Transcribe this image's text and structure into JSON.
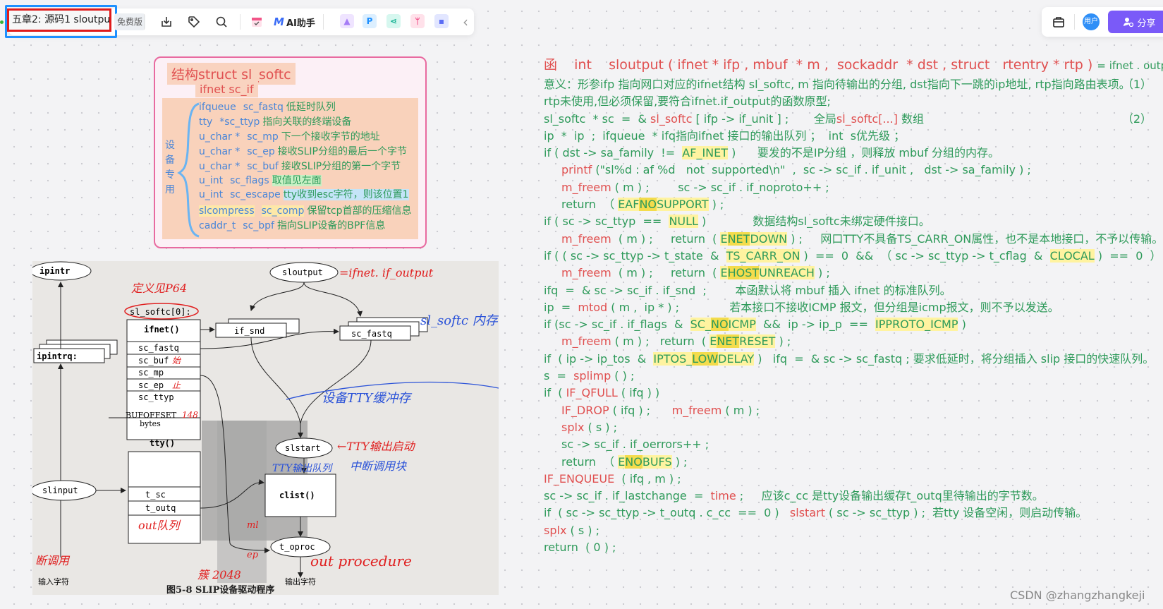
{
  "toolbar": {
    "doc_title": "五章2: 源码1 sloutput",
    "plan_badge": "免费版",
    "icons": [
      "download-icon",
      "tag-icon",
      "search-icon",
      "calendar-icon"
    ],
    "ai_label": "AI助手",
    "app_icons": [
      {
        "name": "image-app",
        "glyph": "▲",
        "bg": "#efe4ff",
        "fg": "#a57cf6"
      },
      {
        "name": "p-app",
        "glyph": "P",
        "bg": "#dcefff",
        "fg": "#1e90ff"
      },
      {
        "name": "mindmap-app",
        "glyph": "⋖",
        "bg": "#d6f7ef",
        "fg": "#19b394"
      },
      {
        "name": "flow-app",
        "glyph": "ᛘ",
        "bg": "#ffe1ea",
        "fg": "#f0508a"
      },
      {
        "name": "chat-app",
        "glyph": "▪",
        "bg": "#e2e6ff",
        "fg": "#5a6cf5"
      }
    ],
    "collapse_glyph": "‹"
  },
  "right_toolbar": {
    "briefcase_glyph": "⌂",
    "avatar_label": "用户",
    "share_label": "分享",
    "share_color": "#7a5af8"
  },
  "struct_card": {
    "title": "结构struct   sl_softc",
    "subtitle": "ifnet   sc_if",
    "vertical_label": [
      "设",
      "备",
      "专",
      "用"
    ],
    "fields": [
      {
        "type": "ifqueue",
        "name": "sc_fastq",
        "desc": "低延时队列",
        "hl": ""
      },
      {
        "type": "tty",
        "name": "*sc_ttyp",
        "desc": "指向关联的终端设备",
        "hl": ""
      },
      {
        "type": "u_char *",
        "name": "sc_mp",
        "desc": "下一个接收字节的地址",
        "hl": ""
      },
      {
        "type": "u_char *",
        "name": "sc_ep",
        "desc": "接收SLIP分组的最后一个字节",
        "hl": ""
      },
      {
        "type": "u_char *",
        "name": "sc_buf",
        "desc": "接收SLIP分组的第一个字节",
        "hl": ""
      },
      {
        "type": "u_int",
        "name": "sc_flags",
        "desc": "取值见左面",
        "hl": "green"
      },
      {
        "type": "u_int",
        "name": "sc_escape",
        "desc": "tty收到esc字符，则该位置1",
        "hl": "blue"
      },
      {
        "type": "slcompress",
        "name": "sc_comp",
        "desc": "保留tcp首部的压缩信息",
        "hl": "yellow-type"
      },
      {
        "type": "caddr_t",
        "name": "sc_bpf",
        "desc": "指向SLIP设备的BPF信息",
        "hl": ""
      }
    ]
  },
  "photo": {
    "caption": "图5-8  SLIP设备驱动程序",
    "nodes": [
      "ipintr",
      "ipintrq:",
      "sloutput",
      "sl_softc[0]:",
      "ifnet()",
      "sc_fastq",
      "sc_buf",
      "sc_mp",
      "sc_ep",
      "sc_ttyp",
      "if_snd",
      "sc_fastq",
      "BUFOFFSET",
      "bytes",
      "slstart",
      "tty()",
      "t_sc",
      "t_outq",
      "clist()",
      "slinput",
      "t_oproc",
      "输入字符",
      "输出字符"
    ],
    "annotations_red": [
      "=ifnet. if_output",
      "定义见P64",
      "始",
      "止",
      "148",
      "←TTY输出启动",
      "out队列",
      "ml",
      "ep",
      "out procedure",
      "断调用",
      "簇 2048"
    ],
    "annotations_blue": [
      "sl_softc 内存",
      "设备TTY缓冲存",
      "中断调用块",
      "TTY输出队列"
    ]
  },
  "code": {
    "lines": [
      {
        "parts": [
          [
            "r",
            "函    int    sloutput ( ifnet * ifp , mbuf  * m ,  sockaddr  * dst , struct   rtentry * rtp ) "
          ],
          [
            "g",
            "= ifnet . output"
          ]
        ],
        "indent": 0,
        "big": true
      },
      {
        "parts": [
          [
            "g",
            "意义：形参ifp 指向网口对应的ifnet结构 sl_softc, m 指向待输出的分组, dst指向下一跳的ip地址, rtp指向路由表项。"
          ]
        ],
        "indent": 0,
        "num": "（1）"
      },
      {
        "parts": [
          [
            "g",
            "rtp未使用,但必须保留,要符合ifnet.if_output的函数原型;"
          ]
        ],
        "indent": 0
      },
      {
        "parts": [
          [
            "g",
            "sl_softc  * sc  =  & "
          ],
          [
            "r",
            "sl_softc"
          ],
          [
            "g",
            " [ ifp -> if_unit ] ;       全局"
          ],
          [
            "r",
            "sl_softc[...]"
          ],
          [
            "g",
            " 数组"
          ]
        ],
        "indent": 0,
        "num": "（2）"
      },
      {
        "parts": [
          [
            "g",
            "ip  *  ip  ;  ifqueue  * ifq指向ifnet 接口的输出队列 ；  int  s优先级 ；"
          ]
        ],
        "indent": 0
      },
      {
        "parts": [
          [
            "g",
            "if ( dst -> sa_family  !=  "
          ],
          [
            "y",
            "AF_INET"
          ],
          [
            "g",
            " )      要发的不是IP分组 ，则释放 mbuf 分组的内存。"
          ]
        ],
        "indent": 0
      },
      {
        "parts": [
          [
            "r",
            "printf"
          ],
          [
            "g",
            " (\"sl%d : af %d   not  supported\\n\"  ,  sc -> sc_if . if_unit ,   dst -> sa_family ) ;"
          ]
        ],
        "indent": 1
      },
      {
        "parts": [
          [
            "r",
            "m_freem"
          ],
          [
            "g",
            " ( m ) ;        sc -> sc_if . if_noproto++ ;"
          ]
        ],
        "indent": 1
      },
      {
        "parts": [
          [
            "g",
            "return  （ "
          ],
          [
            "y",
            "EAF"
          ],
          [
            "yd",
            "NO"
          ],
          [
            "y",
            "SUPPORT"
          ],
          [
            "g",
            " ) ;"
          ]
        ],
        "indent": 1
      },
      {
        "parts": [
          [
            "g",
            "if ( sc -> sc_ttyp  ==  "
          ],
          [
            "y",
            "NULL"
          ],
          [
            "g",
            " )             数据结构sl_softc未绑定硬件接口。"
          ]
        ],
        "indent": 0
      },
      {
        "parts": [
          [
            "r",
            "m_freem"
          ],
          [
            "g",
            "  ( m ) ;     return  ( "
          ],
          [
            "y",
            "E"
          ],
          [
            "yd",
            "NET"
          ],
          [
            "y",
            "DOWN"
          ],
          [
            "g",
            " ) ;     网口TTY不具备TS_CARR_ON属性，也不是本地接口，不予以传输。"
          ]
        ],
        "indent": 1
      },
      {
        "parts": [
          [
            "g",
            "if ( ( sc -> sc_ttyp -> t_state  &  "
          ],
          [
            "y",
            "TS_CARR_ON"
          ],
          [
            "g",
            " )  ==  0  &&  （ sc -> sc_ttyp -> t_cflag  &  "
          ],
          [
            "y",
            "CLOCAL"
          ],
          [
            "g",
            " )  ==  0  ）"
          ]
        ],
        "indent": 0
      },
      {
        "parts": [
          [
            "r",
            "m_freem"
          ],
          [
            "g",
            "  ( m ) ;     return  ( "
          ],
          [
            "y",
            "E"
          ],
          [
            "yd",
            "HOST"
          ],
          [
            "y",
            "UNREACH"
          ],
          [
            "g",
            " ) ;"
          ]
        ],
        "indent": 1
      },
      {
        "parts": [
          [
            "g",
            "ifq  =  & sc -> sc_if . if_snd  ;        本函默认将 mbuf 插入 ifnet 的标准队列。"
          ]
        ],
        "indent": 0
      },
      {
        "parts": [
          [
            "g",
            "ip  =  "
          ],
          [
            "r",
            "mtod"
          ],
          [
            "g",
            " ( m ,  ip * ) ;              若本接口不接收ICMP 报文，但分组是icmp报文，则不予以发送。"
          ]
        ],
        "indent": 0
      },
      {
        "parts": [
          [
            "g",
            "if (sc -> sc_if . if_flags  &  "
          ],
          [
            "y",
            "SC_"
          ],
          [
            "yd",
            "NO"
          ],
          [
            "y",
            "ICMP"
          ],
          [
            "g",
            "  &&  ip -> ip_p  ==  "
          ],
          [
            "y",
            "IPPROTO_ICMP"
          ],
          [
            "g",
            " )"
          ]
        ],
        "indent": 0
      },
      {
        "parts": [
          [
            "r",
            "m_freem"
          ],
          [
            "g",
            " ( m ) ;   return  ( "
          ],
          [
            "y",
            "E"
          ],
          [
            "yd",
            "NET"
          ],
          [
            "y",
            "RESET"
          ],
          [
            "g",
            " ) ;"
          ]
        ],
        "indent": 1
      },
      {
        "parts": [
          [
            "g",
            "if  ( ip -> ip_tos  &  "
          ],
          [
            "y",
            "IPTOS_"
          ],
          [
            "yd",
            "LOW"
          ],
          [
            "y",
            "DELAY"
          ],
          [
            "g",
            " )   ifq  =  & sc -> sc_fastq ; 要求低延时，将分组插入 slip 接口的快速队列。"
          ]
        ],
        "indent": 0
      },
      {
        "parts": [
          [
            "g",
            "s  =  "
          ],
          [
            "r",
            "splimp"
          ],
          [
            "g",
            " ( ) ;"
          ]
        ],
        "indent": 0
      },
      {
        "parts": [
          [
            "g",
            "if  ( "
          ],
          [
            "r",
            "IF_QFULL"
          ],
          [
            "g",
            " ( ifq ) )"
          ]
        ],
        "indent": 0
      },
      {
        "parts": [
          [
            "r",
            "IF_DROP"
          ],
          [
            "g",
            " ( ifq ) ;      "
          ],
          [
            "r",
            "m_freem"
          ],
          [
            "g",
            " ( m ) ;"
          ]
        ],
        "indent": 1
      },
      {
        "parts": [
          [
            "r",
            "splx"
          ],
          [
            "g",
            " ( s ) ;"
          ]
        ],
        "indent": 1
      },
      {
        "parts": [
          [
            "g",
            "sc -> sc_if . if_oerrors++ ;"
          ]
        ],
        "indent": 1
      },
      {
        "parts": [
          [
            "g",
            "return  （ "
          ],
          [
            "y",
            "E"
          ],
          [
            "yd",
            "NO"
          ],
          [
            "y",
            "BUFS"
          ],
          [
            "g",
            " ) ;"
          ]
        ],
        "indent": 1
      },
      {
        "parts": [
          [
            "r",
            "IF_ENQUEUE"
          ],
          [
            "g",
            "  ( ifq , m ) ;"
          ]
        ],
        "indent": 0
      },
      {
        "parts": [
          [
            "g",
            "sc -> sc_if . if_lastchange  =  "
          ],
          [
            "r",
            "time"
          ],
          [
            "g",
            " ;     应该c_cc 是tty设备输出缓存t_outq里待输出的字节数。"
          ]
        ],
        "indent": 0
      },
      {
        "parts": [
          [
            "g",
            "if  ( sc -> sc_ttyp -> t_outq . c_cc  ==  0 )   "
          ],
          [
            "r",
            "slstart"
          ],
          [
            "g",
            " ( sc -> sc_ttyp ) ;  若tty 设备空闲，则启动传输。"
          ]
        ],
        "indent": 0
      },
      {
        "parts": [
          [
            "r",
            "splx"
          ],
          [
            "g",
            " ( s ) ;"
          ]
        ],
        "indent": 0
      },
      {
        "parts": [
          [
            "g",
            "return  ( 0 ) ;"
          ]
        ],
        "indent": 0
      }
    ]
  },
  "watermark": "CSDN @zhangzhangkeji"
}
